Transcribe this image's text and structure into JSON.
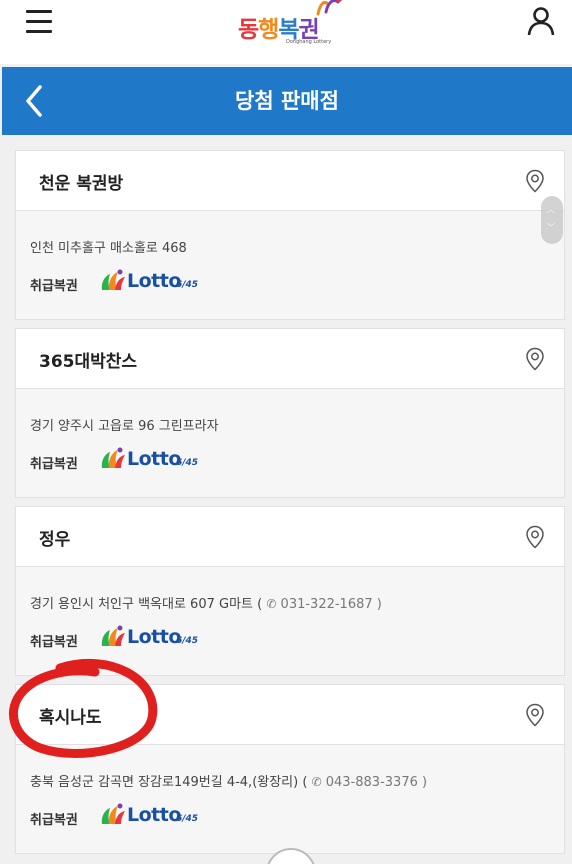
{
  "header": {
    "logo": {
      "text_parts": [
        "동",
        "행",
        "복",
        "권"
      ],
      "subtitle": "Donghang Lottery"
    }
  },
  "titlebar": {
    "title": "당첨 판매점",
    "color": "#1f78c8"
  },
  "stores": [
    {
      "name": "천운 복권방",
      "address": "인천 미추홀구 매소홀로 468",
      "phone": "",
      "tag_label": "취급복권",
      "lotto_word": "Lotto",
      "lotto_num": "6/45"
    },
    {
      "name": "365대박찬스",
      "address": "경기 양주시 고읍로 96 그린프라자",
      "phone": "",
      "tag_label": "취급복권",
      "lotto_word": "Lotto",
      "lotto_num": "6/45"
    },
    {
      "name": "정우",
      "address": "경기 용인시 처인구 백옥대로 607 G마트 (",
      "phone": "031-322-1687 )",
      "tag_label": "취급복권",
      "lotto_word": "Lotto",
      "lotto_num": "6/45"
    },
    {
      "name": "혹시나도",
      "address": "충북 음성군 감곡면 장감로149번길 4-4,(왕장리) (",
      "phone": "043-883-3376 )",
      "tag_label": "취급복권",
      "lotto_word": "Lotto",
      "lotto_num": "6/45"
    }
  ],
  "icons": {
    "menu": "hamburger-menu-icon",
    "user": "user-icon",
    "back": "chevron-left-icon",
    "pin": "map-pin-icon",
    "phone": "phone-icon"
  }
}
